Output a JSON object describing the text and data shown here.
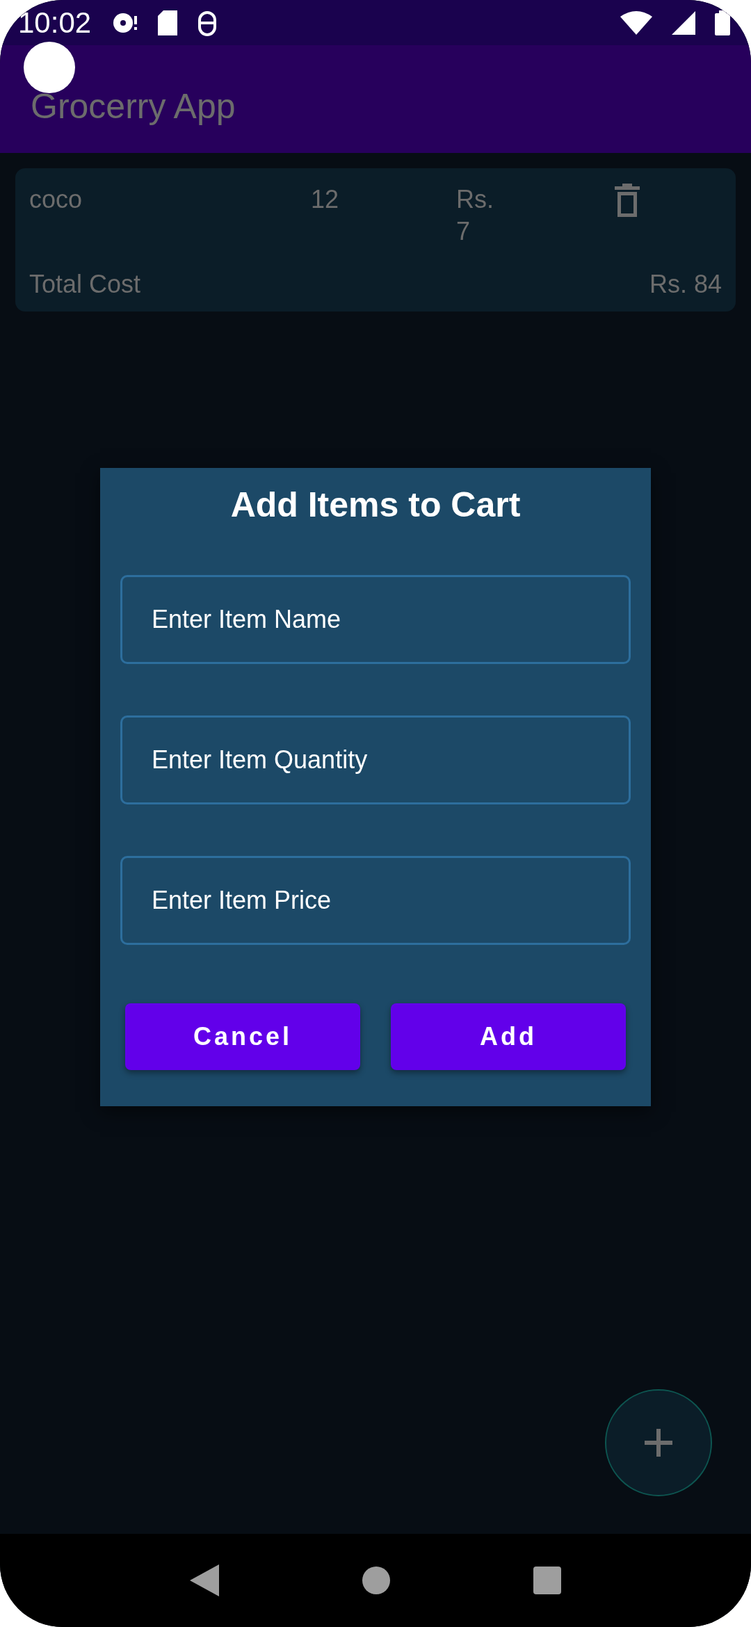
{
  "status_bar": {
    "time": "10:02"
  },
  "app_bar": {
    "title": "Grocerry App"
  },
  "cart_items": [
    {
      "name": "coco",
      "quantity": "12",
      "price": "Rs. 7"
    }
  ],
  "total": {
    "label": "Total Cost",
    "value": "Rs. 84"
  },
  "dialog": {
    "title": "Add Items to Cart",
    "fields": [
      {
        "placeholder": "Enter Item Name"
      },
      {
        "placeholder": "Enter Item Quantity"
      },
      {
        "placeholder": "Enter Item Price"
      }
    ],
    "buttons": [
      "Cancel",
      "Add"
    ]
  }
}
